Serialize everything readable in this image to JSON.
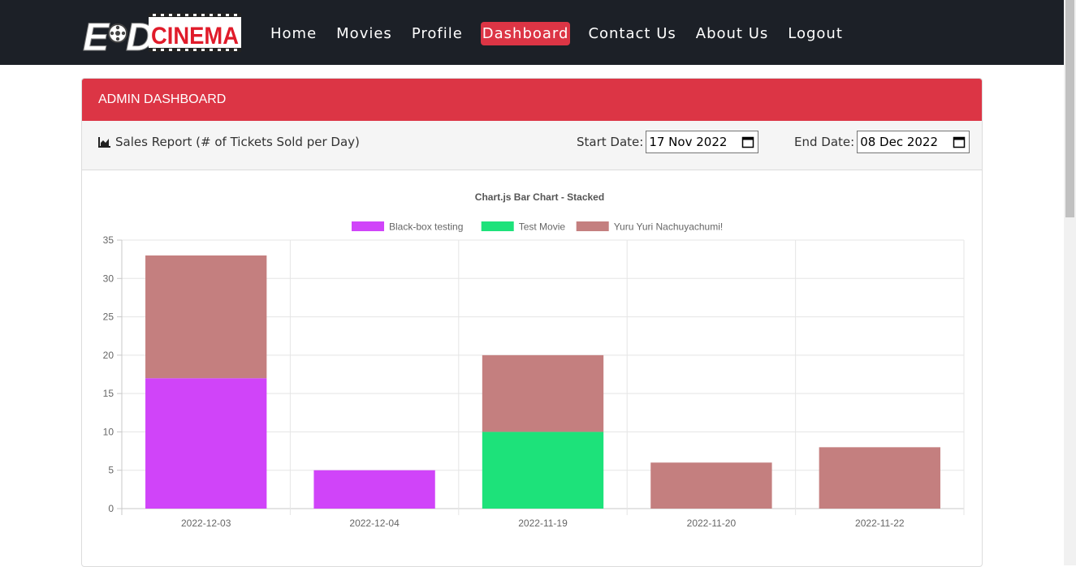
{
  "brand": {
    "logo_text_left": "EKD",
    "logo_text_right": "CINEMA"
  },
  "nav": {
    "items": [
      {
        "label": "Home",
        "active": false
      },
      {
        "label": "Movies",
        "active": false
      },
      {
        "label": "Profile",
        "active": false
      },
      {
        "label": "Dashboard",
        "active": true
      },
      {
        "label": "Contact Us",
        "active": false
      },
      {
        "label": "About Us",
        "active": false
      },
      {
        "label": "Logout",
        "active": false
      }
    ]
  },
  "dashboard": {
    "header": "ADMIN DASHBOARD",
    "report_title": "Sales Report (# of Tickets Sold per Day)",
    "report_icon": "area-chart-icon",
    "start_date_label": "Start Date:",
    "start_date_value": "17 Nov 2022",
    "end_date_label": "End Date:",
    "end_date_value": "08 Dec 2022"
  },
  "colors": {
    "accent": "#dc3545",
    "navbar": "#1c2027"
  },
  "chart_data": {
    "type": "bar",
    "stacked": true,
    "title": "Chart.js Bar Chart - Stacked",
    "categories": [
      "2022-12-03",
      "2022-12-04",
      "2022-11-19",
      "2022-11-20",
      "2022-11-22"
    ],
    "series": [
      {
        "name": "Black-box testing",
        "color": "#d044f9",
        "values": [
          17,
          5,
          0,
          0,
          0
        ]
      },
      {
        "name": "Test Movie",
        "color": "#1de27a",
        "values": [
          0,
          0,
          10,
          0,
          0
        ]
      },
      {
        "name": "Yuru Yuri Nachuyachumi!",
        "color": "#c47f7f",
        "values": [
          16,
          0,
          10,
          6,
          8
        ]
      }
    ],
    "ylim": [
      0,
      35
    ],
    "yticks": [
      0,
      5,
      10,
      15,
      20,
      25,
      30,
      35
    ],
    "grid": true,
    "legend_position": "top"
  }
}
